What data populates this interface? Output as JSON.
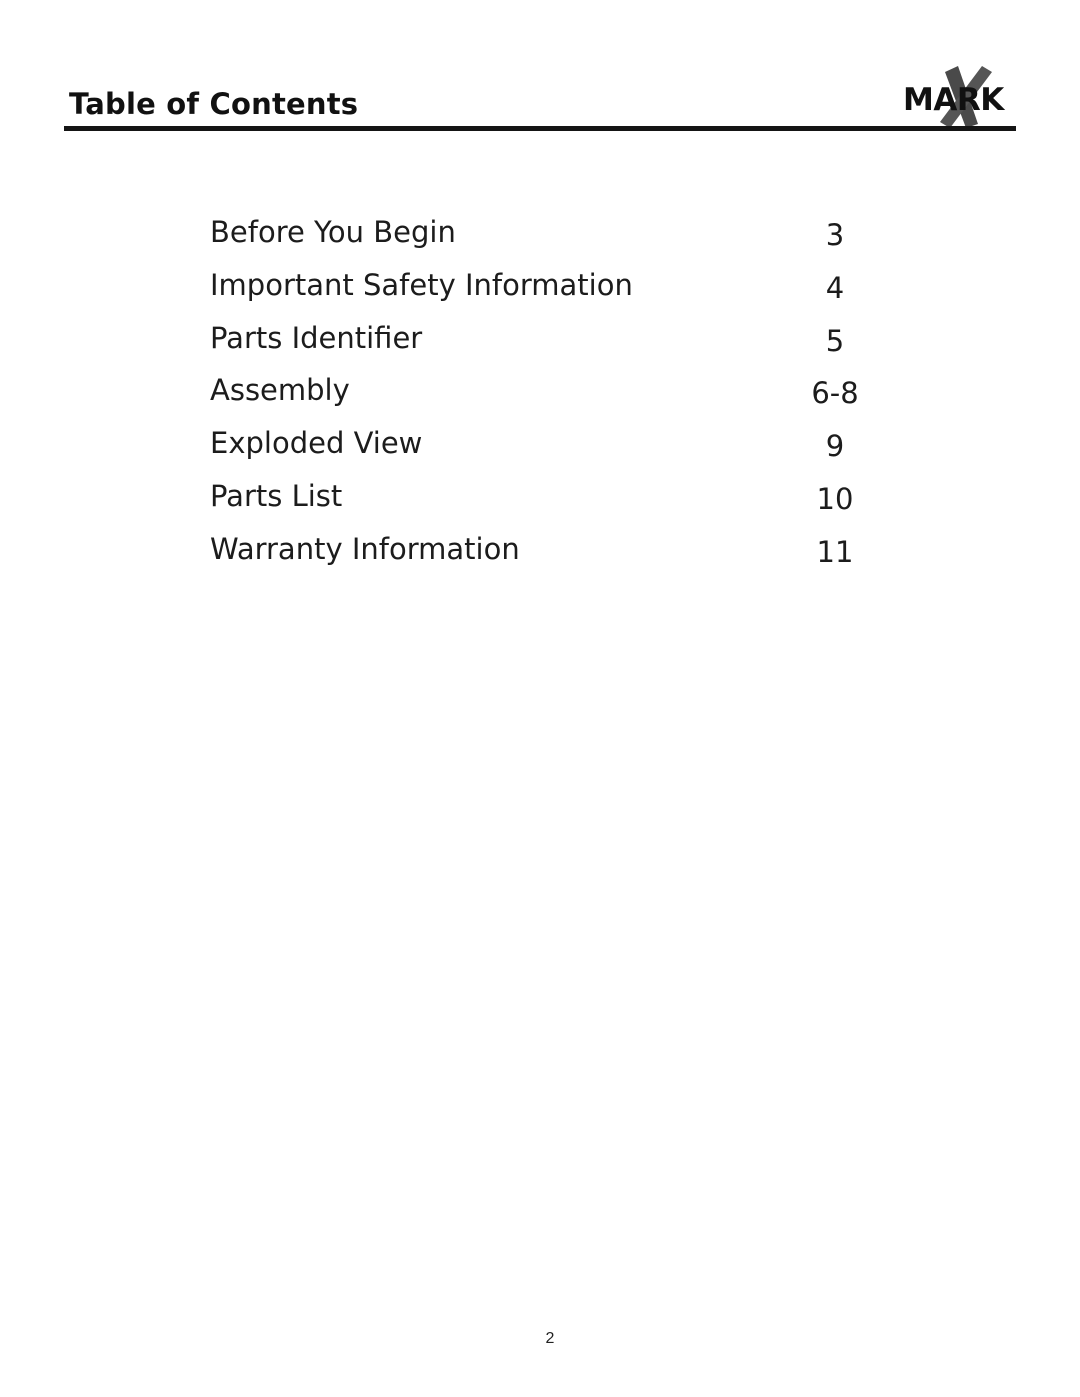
{
  "header": {
    "title": "Table of Contents",
    "logo": {
      "icon": "xmark-logo",
      "text": "MARK",
      "mark_letter": "X",
      "text_color": "#111111",
      "mark_color": "#4a4a4a"
    }
  },
  "toc": {
    "entries": [
      {
        "title": "Before You Begin",
        "page": "3"
      },
      {
        "title": "Important Safety Information",
        "page": "4"
      },
      {
        "title": "Parts Identifier",
        "page": "5"
      },
      {
        "title": "Assembly",
        "page": "6-8"
      },
      {
        "title": "Exploded View",
        "page": "9"
      },
      {
        "title": "Parts List",
        "page": "10"
      },
      {
        "title": "Warranty Information",
        "page": "11"
      }
    ]
  },
  "footer": {
    "page_number": "2"
  }
}
